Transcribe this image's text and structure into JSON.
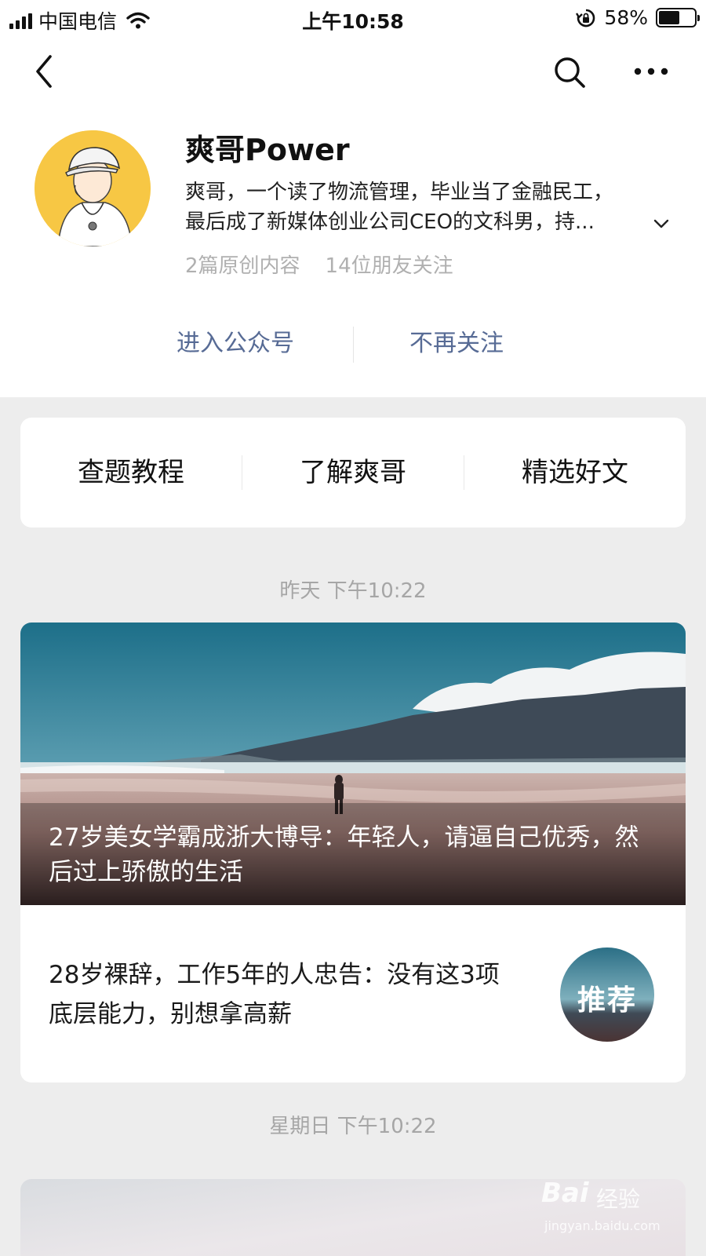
{
  "status_bar": {
    "carrier": "中国电信",
    "time": "上午10:58",
    "battery_percent": "58%",
    "battery_level": 0.58
  },
  "nav": {
    "back_icon": "chevron-left-icon",
    "search_icon": "search-icon",
    "more_icon": "more-horizontal-icon"
  },
  "profile": {
    "name": "爽哥Power",
    "bio_line1": "爽哥，一个读了物流管理，毕业当了金融民工，",
    "bio_line2": "最后成了新媒体创业公司CEO的文科男，持...",
    "original_count": "2篇原创内容",
    "friends_following": "14位朋友关注",
    "avatar_bg": "#f7c744"
  },
  "actions": {
    "enter": "进入公众号",
    "unfollow": "不再关注",
    "link_color": "#576b95"
  },
  "menu": {
    "items": [
      "查题教程",
      "了解爽哥",
      "精选好文"
    ]
  },
  "feed": {
    "timestamp1": "昨天 下午10:22",
    "cover_title": "27岁美女学霸成浙大博导：年轻人，请逼自己优秀，然后过上骄傲的生活",
    "sub_title": "28岁裸辞，工作5年的人忠告：没有这3项底层能力，别想拿高薪",
    "sub_thumb_label": "推荐",
    "timestamp2": "星期日 下午10:22"
  },
  "watermark": {
    "brand": "Bai",
    "sub": "经验",
    "url": "jingyan.baidu.com"
  }
}
